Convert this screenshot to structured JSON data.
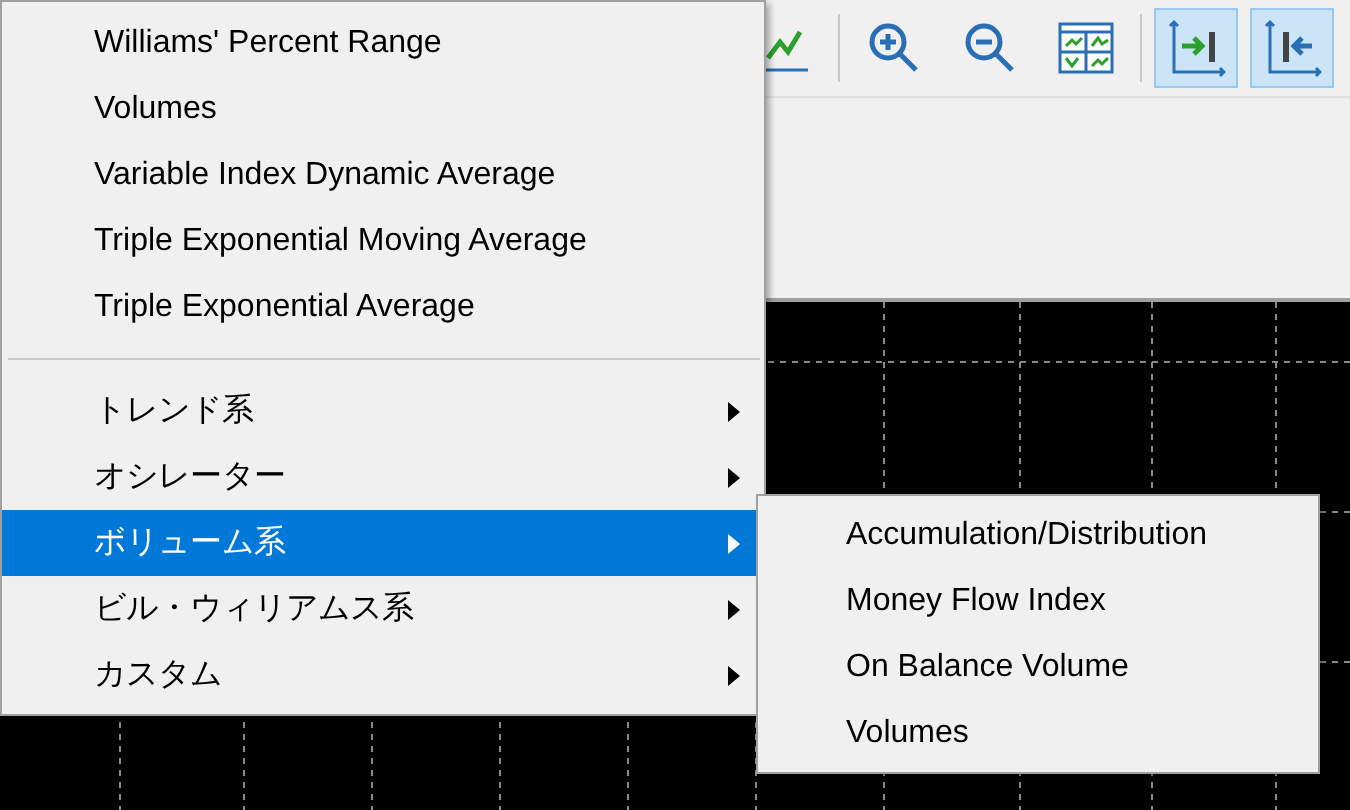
{
  "toolbar": [
    {
      "kind": "line-chart",
      "pressed": false
    },
    {
      "kind": "zoom-in",
      "pressed": false
    },
    {
      "kind": "zoom-out",
      "pressed": false
    },
    {
      "kind": "tile",
      "pressed": false
    },
    {
      "kind": "shift-end",
      "pressed": true
    },
    {
      "kind": "auto-scroll",
      "pressed": true
    }
  ],
  "menu": {
    "items": [
      {
        "kind": "item",
        "label": "Williams' Percent Range",
        "selected": false
      },
      {
        "kind": "item",
        "label": "Volumes",
        "selected": false
      },
      {
        "kind": "item",
        "label": "Variable Index Dynamic Average",
        "selected": false
      },
      {
        "kind": "item",
        "label": "Triple Exponential Moving Average",
        "selected": false
      },
      {
        "kind": "item",
        "label": "Triple Exponential Average",
        "selected": false
      },
      {
        "kind": "separator"
      },
      {
        "kind": "submenu",
        "label": "トレンド系",
        "selected": false
      },
      {
        "kind": "submenu",
        "label": "オシレーター",
        "selected": false
      },
      {
        "kind": "submenu",
        "label": "ボリューム系",
        "selected": true
      },
      {
        "kind": "submenu",
        "label": "ビル・ウィリアムス系",
        "selected": false
      },
      {
        "kind": "submenu",
        "label": "カスタム",
        "selected": false
      }
    ]
  },
  "submenu": {
    "items": [
      {
        "label": "Accumulation/Distribution"
      },
      {
        "label": "Money Flow Index"
      },
      {
        "label": "On Balance Volume"
      },
      {
        "label": "Volumes"
      }
    ]
  }
}
